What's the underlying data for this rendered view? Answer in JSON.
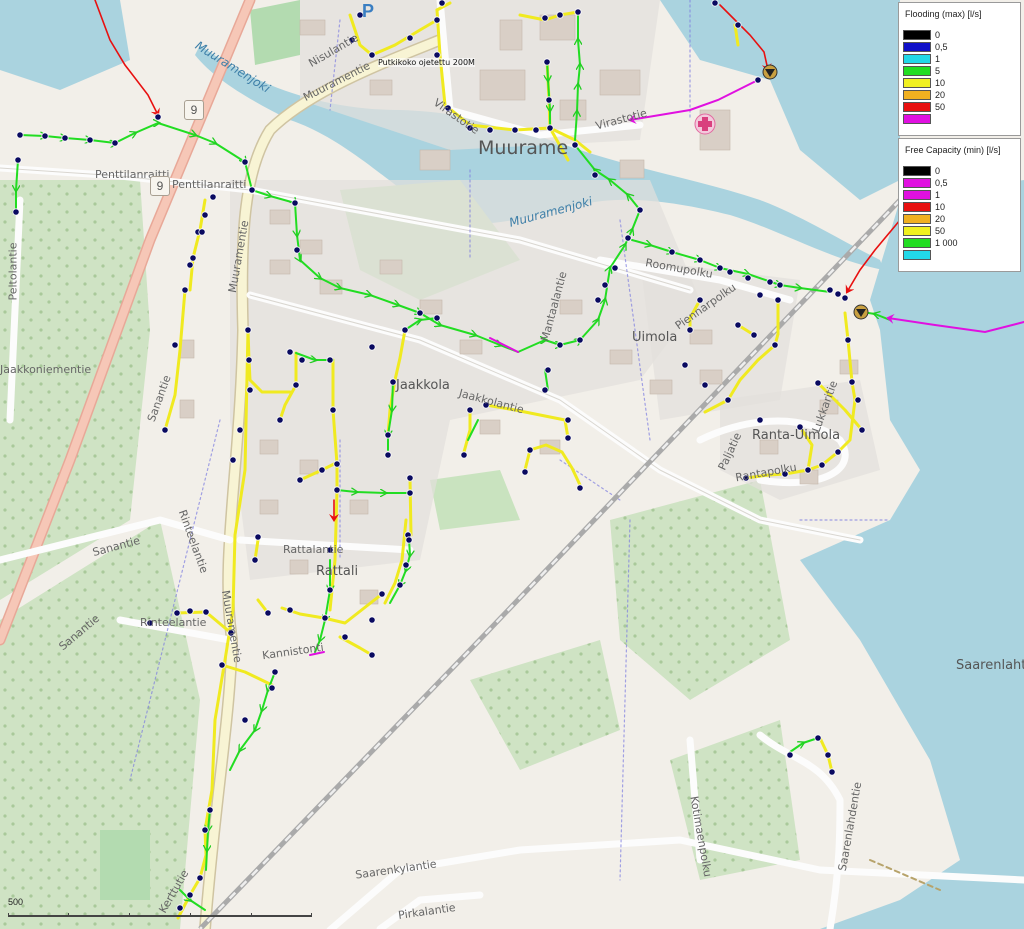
{
  "map": {
    "road_labels": [
      "Nisulantie",
      "Muuramentie",
      "Virastotie",
      "Virastotie",
      "Penttilanraitti",
      "Penttilanraitti",
      "Peltolantie",
      "Jaakkoniementie",
      "Muuramentie",
      "Sanantie",
      "Sanantie",
      "Sanantie",
      "Rinteelantie",
      "Rinteelantie",
      "Muuramentie",
      "Rattalantie",
      "Kannistonti",
      "Kerttutie",
      "Saarenkylantie",
      "Pirkalantie",
      "Roomupolku",
      "Piennarpolku",
      "Mantaalantie",
      "Jaakkolantie",
      "Lukkaritie",
      "Paljatie",
      "Rantapolku",
      "Saarenlahdentie",
      "Kotimaenpolku"
    ],
    "road_shields": [
      "9",
      "9"
    ],
    "place_labels": [
      "Muurame",
      "Uimola",
      "Jaakkola",
      "Ranta-Uimola",
      "Rattali",
      "Saarenlahti"
    ],
    "water_labels": [
      "Muuramenjoki",
      "Muuramenjoki"
    ],
    "annotation": "Putkikoko ojetettu 200M"
  },
  "legend_flooding": {
    "title": "Flooding (max) [l/s]",
    "items": [
      {
        "label": "0",
        "color": "#000000"
      },
      {
        "label": "0,5",
        "color": "#1010c8"
      },
      {
        "label": "1",
        "color": "#22d8e8"
      },
      {
        "label": "5",
        "color": "#22dd22"
      },
      {
        "label": "10",
        "color": "#f0f020"
      },
      {
        "label": "20",
        "color": "#f0b020"
      },
      {
        "label": "50",
        "color": "#e81010"
      },
      {
        "label": "",
        "color": "#e010e0"
      }
    ]
  },
  "legend_capacity": {
    "title": "Free Capacity (min) [l/s]",
    "items": [
      {
        "label": "0",
        "color": "#000000"
      },
      {
        "label": "0,5",
        "color": "#e010e0"
      },
      {
        "label": "1",
        "color": "#e010e0"
      },
      {
        "label": "10",
        "color": "#e81010"
      },
      {
        "label": "20",
        "color": "#f0b020"
      },
      {
        "label": "50",
        "color": "#f0f020"
      },
      {
        "label": "1 000",
        "color": "#22dd22"
      },
      {
        "label": "",
        "color": "#22d8e8"
      }
    ]
  },
  "scale_bar": {
    "label": "500"
  }
}
